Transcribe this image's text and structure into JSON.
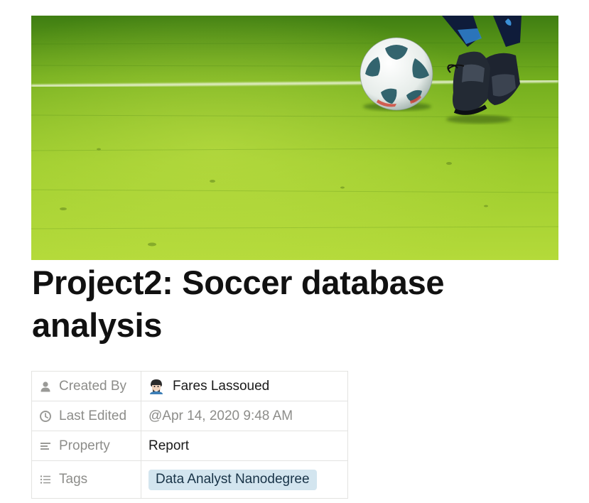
{
  "page": {
    "title": "Project2: Soccer database analysis",
    "cover_alt": "soccer-ball-on-grass-cover"
  },
  "properties": [
    {
      "icon": "person-icon",
      "name": "Created By",
      "value": "Fares Lassoued",
      "has_avatar": true
    },
    {
      "icon": "clock-icon",
      "name": "Last Edited",
      "value": "@Apr 14, 2020 9:48 AM"
    },
    {
      "icon": "text-lines-icon",
      "name": "Property",
      "value": "Report"
    },
    {
      "icon": "list-icon",
      "name": "Tags",
      "value": "Data Analyst Nanodegree",
      "tag_color": "#d3e5ef"
    }
  ],
  "colors": {
    "grass_light": "#a6d22e",
    "grass_dark": "#4d8a14",
    "tag_bg": "#d3e5ef",
    "muted_text": "#8d8d8a"
  }
}
